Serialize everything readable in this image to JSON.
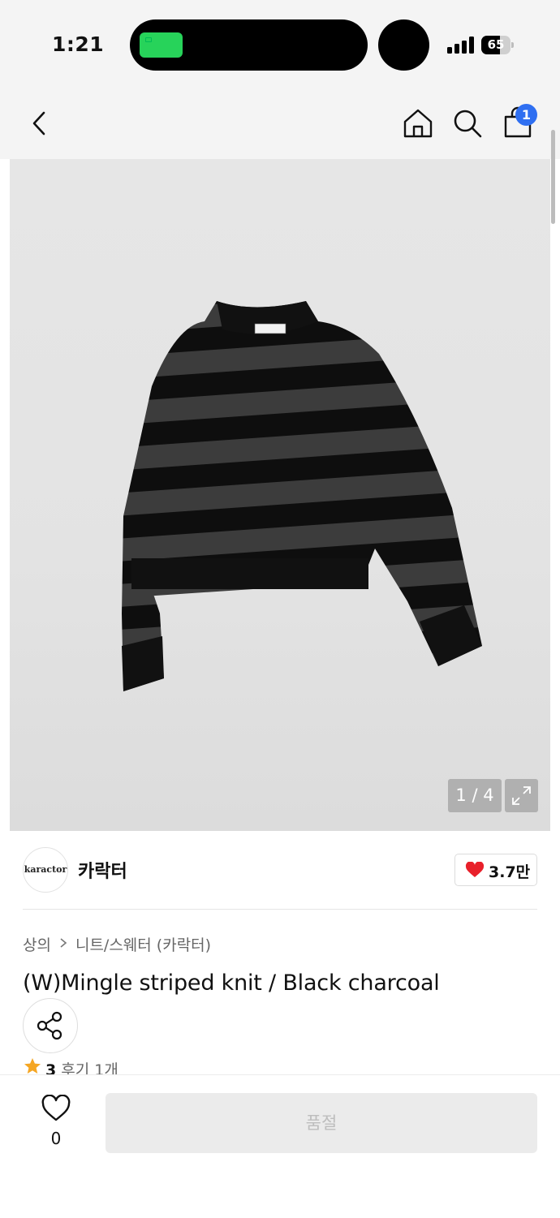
{
  "status_bar": {
    "time": "1:21",
    "battery_level": "65",
    "battery_fraction": 0.65,
    "signal_bars": 4
  },
  "nav": {
    "back_icon": "chevron-left-icon",
    "home_icon": "home-icon",
    "search_icon": "search-icon",
    "cart_icon": "shopping-bag-icon",
    "cart_badge": "1",
    "badge_color": "#2f6ff1"
  },
  "gallery": {
    "counter": "1 / 4",
    "expand_icon": "expand-icon",
    "image_subject": "striped knit sweater, black and charcoal"
  },
  "brand": {
    "logo_text": "karactor",
    "name": "카락터",
    "like_count": "3.7만",
    "like_color": "#e8202a"
  },
  "product": {
    "breadcrumb": [
      "상의",
      "니트/스웨터 (카락터)"
    ],
    "title": "(W)Mingle striped knit / Black charcoal",
    "share_icon": "share-icon",
    "rating": "3",
    "review_text": "후기 1개",
    "star_color": "#f5a623"
  },
  "bottom_bar": {
    "wish_icon": "heart-outline-icon",
    "wish_count": "0",
    "buy_label": "품절"
  }
}
